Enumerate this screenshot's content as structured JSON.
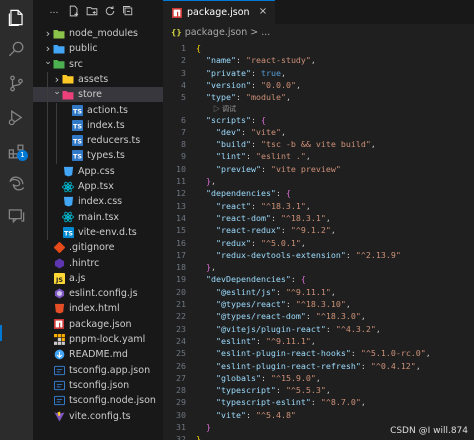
{
  "explorer": {
    "toolbar_ellipsis": "…",
    "items": [
      {
        "name": "node_modules",
        "kind": "folder",
        "depth": 0,
        "expanded": false,
        "icon": "folder-node-icon"
      },
      {
        "name": "public",
        "kind": "folder",
        "depth": 0,
        "expanded": false,
        "icon": "folder-public-icon"
      },
      {
        "name": "src",
        "kind": "folder",
        "depth": 0,
        "expanded": true,
        "icon": "folder-src-icon"
      },
      {
        "name": "assets",
        "kind": "folder",
        "depth": 1,
        "expanded": false,
        "icon": "folder-assets-icon"
      },
      {
        "name": "store",
        "kind": "folder",
        "depth": 1,
        "expanded": true,
        "icon": "folder-store-icon",
        "selected": true
      },
      {
        "name": "action.ts",
        "kind": "file",
        "depth": 2,
        "icon": "typescript-file-icon"
      },
      {
        "name": "index.ts",
        "kind": "file",
        "depth": 2,
        "icon": "typescript-file-icon"
      },
      {
        "name": "reducers.ts",
        "kind": "file",
        "depth": 2,
        "icon": "typescript-file-icon"
      },
      {
        "name": "types.ts",
        "kind": "file",
        "depth": 2,
        "icon": "typescript-file-icon"
      },
      {
        "name": "App.css",
        "kind": "file",
        "depth": 1,
        "icon": "css-file-icon"
      },
      {
        "name": "App.tsx",
        "kind": "file",
        "depth": 1,
        "icon": "react-file-icon"
      },
      {
        "name": "index.css",
        "kind": "file",
        "depth": 1,
        "icon": "css-file-icon"
      },
      {
        "name": "main.tsx",
        "kind": "file",
        "depth": 1,
        "icon": "react-file-icon"
      },
      {
        "name": "vite-env.d.ts",
        "kind": "file",
        "depth": 1,
        "icon": "typescript-def-file-icon"
      },
      {
        "name": ".gitignore",
        "kind": "file",
        "depth": 0,
        "icon": "git-file-icon"
      },
      {
        "name": ".hintrc",
        "kind": "file",
        "depth": 0,
        "icon": "hintrc-file-icon"
      },
      {
        "name": "a.js",
        "kind": "file",
        "depth": 0,
        "icon": "javascript-file-icon"
      },
      {
        "name": "eslint.config.js",
        "kind": "file",
        "depth": 0,
        "icon": "eslint-file-icon"
      },
      {
        "name": "index.html",
        "kind": "file",
        "depth": 0,
        "icon": "html-file-icon"
      },
      {
        "name": "package.json",
        "kind": "file",
        "depth": 0,
        "icon": "npm-file-icon"
      },
      {
        "name": "pnpm-lock.yaml",
        "kind": "file",
        "depth": 0,
        "icon": "pnpm-file-icon"
      },
      {
        "name": "README.md",
        "kind": "file",
        "depth": 0,
        "icon": "markdown-file-icon"
      },
      {
        "name": "tsconfig.app.json",
        "kind": "file",
        "depth": 0,
        "icon": "tsconfig-file-icon"
      },
      {
        "name": "tsconfig.json",
        "kind": "file",
        "depth": 0,
        "icon": "tsconfig-file-icon"
      },
      {
        "name": "tsconfig.node.json",
        "kind": "file",
        "depth": 0,
        "icon": "tsconfig-file-icon"
      },
      {
        "name": "vite.config.ts",
        "kind": "file",
        "depth": 0,
        "icon": "vite-file-icon"
      }
    ]
  },
  "activity_bar": {
    "extensions_badge": "1"
  },
  "editor": {
    "tab_label": "package.json",
    "tab_close": "×",
    "breadcrumb_icon": "{}",
    "breadcrumb": "package.json > ...",
    "codelens_debug": "调试",
    "current_line": 33,
    "lines": [
      {
        "n": 1,
        "code": [
          {
            "t": "{",
            "c": "br1"
          }
        ]
      },
      {
        "n": 2,
        "code": [
          {
            "t": "  "
          },
          {
            "t": "\"name\"",
            "c": "k"
          },
          {
            "t": ": ",
            "c": "p"
          },
          {
            "t": "\"react-study\"",
            "c": "s"
          },
          {
            "t": ",",
            "c": "p"
          }
        ]
      },
      {
        "n": 3,
        "code": [
          {
            "t": "  "
          },
          {
            "t": "\"private\"",
            "c": "k"
          },
          {
            "t": ": ",
            "c": "p"
          },
          {
            "t": "true",
            "c": "b"
          },
          {
            "t": ",",
            "c": "p"
          }
        ]
      },
      {
        "n": 4,
        "code": [
          {
            "t": "  "
          },
          {
            "t": "\"version\"",
            "c": "k"
          },
          {
            "t": ": ",
            "c": "p"
          },
          {
            "t": "\"0.0.0\"",
            "c": "s"
          },
          {
            "t": ",",
            "c": "p"
          }
        ]
      },
      {
        "n": 5,
        "code": [
          {
            "t": "  "
          },
          {
            "t": "\"type\"",
            "c": "k"
          },
          {
            "t": ": ",
            "c": "p"
          },
          {
            "t": "\"module\"",
            "c": "s"
          },
          {
            "t": ",",
            "c": "p"
          }
        ]
      },
      {
        "n": 6,
        "code": [
          {
            "t": "  "
          },
          {
            "t": "\"scripts\"",
            "c": "k"
          },
          {
            "t": ": ",
            "c": "p"
          },
          {
            "t": "{",
            "c": "br2"
          }
        ]
      },
      {
        "n": 7,
        "code": [
          {
            "t": "    "
          },
          {
            "t": "\"dev\"",
            "c": "k"
          },
          {
            "t": ": ",
            "c": "p"
          },
          {
            "t": "\"vite\"",
            "c": "s"
          },
          {
            "t": ",",
            "c": "p"
          }
        ]
      },
      {
        "n": 8,
        "code": [
          {
            "t": "    "
          },
          {
            "t": "\"build\"",
            "c": "k"
          },
          {
            "t": ": ",
            "c": "p"
          },
          {
            "t": "\"tsc -b && vite build\"",
            "c": "s"
          },
          {
            "t": ",",
            "c": "p"
          }
        ]
      },
      {
        "n": 9,
        "code": [
          {
            "t": "    "
          },
          {
            "t": "\"lint\"",
            "c": "k"
          },
          {
            "t": ": ",
            "c": "p"
          },
          {
            "t": "\"eslint .\"",
            "c": "s"
          },
          {
            "t": ",",
            "c": "p"
          }
        ]
      },
      {
        "n": 10,
        "code": [
          {
            "t": "    "
          },
          {
            "t": "\"preview\"",
            "c": "k"
          },
          {
            "t": ": ",
            "c": "p"
          },
          {
            "t": "\"vite preview\"",
            "c": "s"
          }
        ]
      },
      {
        "n": 11,
        "code": [
          {
            "t": "  "
          },
          {
            "t": "}",
            "c": "br2"
          },
          {
            "t": ",",
            "c": "p"
          }
        ]
      },
      {
        "n": 12,
        "code": [
          {
            "t": "  "
          },
          {
            "t": "\"dependencies\"",
            "c": "k"
          },
          {
            "t": ": ",
            "c": "p"
          },
          {
            "t": "{",
            "c": "br2"
          }
        ]
      },
      {
        "n": 13,
        "code": [
          {
            "t": "    "
          },
          {
            "t": "\"react\"",
            "c": "k"
          },
          {
            "t": ": ",
            "c": "p"
          },
          {
            "t": "\"^18.3.1\"",
            "c": "s"
          },
          {
            "t": ",",
            "c": "p"
          }
        ]
      },
      {
        "n": 14,
        "code": [
          {
            "t": "    "
          },
          {
            "t": "\"react-dom\"",
            "c": "k"
          },
          {
            "t": ": ",
            "c": "p"
          },
          {
            "t": "\"^18.3.1\"",
            "c": "s"
          },
          {
            "t": ",",
            "c": "p"
          }
        ]
      },
      {
        "n": 15,
        "code": [
          {
            "t": "    "
          },
          {
            "t": "\"react-redux\"",
            "c": "k"
          },
          {
            "t": ": ",
            "c": "p"
          },
          {
            "t": "\"^9.1.2\"",
            "c": "s"
          },
          {
            "t": ",",
            "c": "p"
          }
        ]
      },
      {
        "n": 16,
        "code": [
          {
            "t": "    "
          },
          {
            "t": "\"redux\"",
            "c": "k"
          },
          {
            "t": ": ",
            "c": "p"
          },
          {
            "t": "\"^5.0.1\"",
            "c": "s"
          },
          {
            "t": ",",
            "c": "p"
          }
        ]
      },
      {
        "n": 17,
        "code": [
          {
            "t": "    "
          },
          {
            "t": "\"redux-devtools-extension\"",
            "c": "k"
          },
          {
            "t": ": ",
            "c": "p"
          },
          {
            "t": "\"^2.13.9\"",
            "c": "s"
          }
        ]
      },
      {
        "n": 18,
        "code": [
          {
            "t": "  "
          },
          {
            "t": "}",
            "c": "br2"
          },
          {
            "t": ",",
            "c": "p"
          }
        ]
      },
      {
        "n": 19,
        "code": [
          {
            "t": "  "
          },
          {
            "t": "\"devDependencies\"",
            "c": "k"
          },
          {
            "t": ": ",
            "c": "p"
          },
          {
            "t": "{",
            "c": "br2"
          }
        ]
      },
      {
        "n": 20,
        "code": [
          {
            "t": "    "
          },
          {
            "t": "\"@eslint/js\"",
            "c": "k"
          },
          {
            "t": ": ",
            "c": "p"
          },
          {
            "t": "\"^9.11.1\"",
            "c": "s"
          },
          {
            "t": ",",
            "c": "p"
          }
        ]
      },
      {
        "n": 21,
        "code": [
          {
            "t": "    "
          },
          {
            "t": "\"@types/react\"",
            "c": "k"
          },
          {
            "t": ": ",
            "c": "p"
          },
          {
            "t": "\"^18.3.10\"",
            "c": "s"
          },
          {
            "t": ",",
            "c": "p"
          }
        ]
      },
      {
        "n": 22,
        "code": [
          {
            "t": "    "
          },
          {
            "t": "\"@types/react-dom\"",
            "c": "k"
          },
          {
            "t": ": ",
            "c": "p"
          },
          {
            "t": "\"^18.3.0\"",
            "c": "s"
          },
          {
            "t": ",",
            "c": "p"
          }
        ]
      },
      {
        "n": 23,
        "code": [
          {
            "t": "    "
          },
          {
            "t": "\"@vitejs/plugin-react\"",
            "c": "k"
          },
          {
            "t": ": ",
            "c": "p"
          },
          {
            "t": "\"^4.3.2\"",
            "c": "s"
          },
          {
            "t": ",",
            "c": "p"
          }
        ]
      },
      {
        "n": 24,
        "code": [
          {
            "t": "    "
          },
          {
            "t": "\"eslint\"",
            "c": "k"
          },
          {
            "t": ": ",
            "c": "p"
          },
          {
            "t": "\"^9.11.1\"",
            "c": "s"
          },
          {
            "t": ",",
            "c": "p"
          }
        ]
      },
      {
        "n": 25,
        "code": [
          {
            "t": "    "
          },
          {
            "t": "\"eslint-plugin-react-hooks\"",
            "c": "k"
          },
          {
            "t": ": ",
            "c": "p"
          },
          {
            "t": "\"^5.1.0-rc.0\"",
            "c": "s"
          },
          {
            "t": ",",
            "c": "p"
          }
        ]
      },
      {
        "n": 26,
        "code": [
          {
            "t": "    "
          },
          {
            "t": "\"eslint-plugin-react-refresh\"",
            "c": "k"
          },
          {
            "t": ": ",
            "c": "p"
          },
          {
            "t": "\"^0.4.12\"",
            "c": "s"
          },
          {
            "t": ",",
            "c": "p"
          }
        ]
      },
      {
        "n": 27,
        "code": [
          {
            "t": "    "
          },
          {
            "t": "\"globals\"",
            "c": "k"
          },
          {
            "t": ": ",
            "c": "p"
          },
          {
            "t": "\"^15.9.0\"",
            "c": "s"
          },
          {
            "t": ",",
            "c": "p"
          }
        ]
      },
      {
        "n": 28,
        "code": [
          {
            "t": "    "
          },
          {
            "t": "\"typescript\"",
            "c": "k"
          },
          {
            "t": ": ",
            "c": "p"
          },
          {
            "t": "\"^5.5.3\"",
            "c": "s"
          },
          {
            "t": ",",
            "c": "p"
          }
        ]
      },
      {
        "n": 29,
        "code": [
          {
            "t": "    "
          },
          {
            "t": "\"typescript-eslint\"",
            "c": "k"
          },
          {
            "t": ": ",
            "c": "p"
          },
          {
            "t": "\"^8.7.0\"",
            "c": "s"
          },
          {
            "t": ",",
            "c": "p"
          }
        ]
      },
      {
        "n": 30,
        "code": [
          {
            "t": "    "
          },
          {
            "t": "\"vite\"",
            "c": "k"
          },
          {
            "t": ": ",
            "c": "p"
          },
          {
            "t": "\"^5.4.8\"",
            "c": "s"
          }
        ]
      },
      {
        "n": 31,
        "code": [
          {
            "t": "  "
          },
          {
            "t": "}",
            "c": "br2"
          }
        ]
      },
      {
        "n": 32,
        "code": [
          {
            "t": "}",
            "c": "br1"
          }
        ]
      },
      {
        "n": 33,
        "code": []
      }
    ]
  },
  "watermark": "CSDN @I will.874",
  "colors": {
    "accent": "#0078d4",
    "json_key": "#9cdcfe",
    "json_string": "#ce9178",
    "json_keyword": "#569cd6"
  }
}
